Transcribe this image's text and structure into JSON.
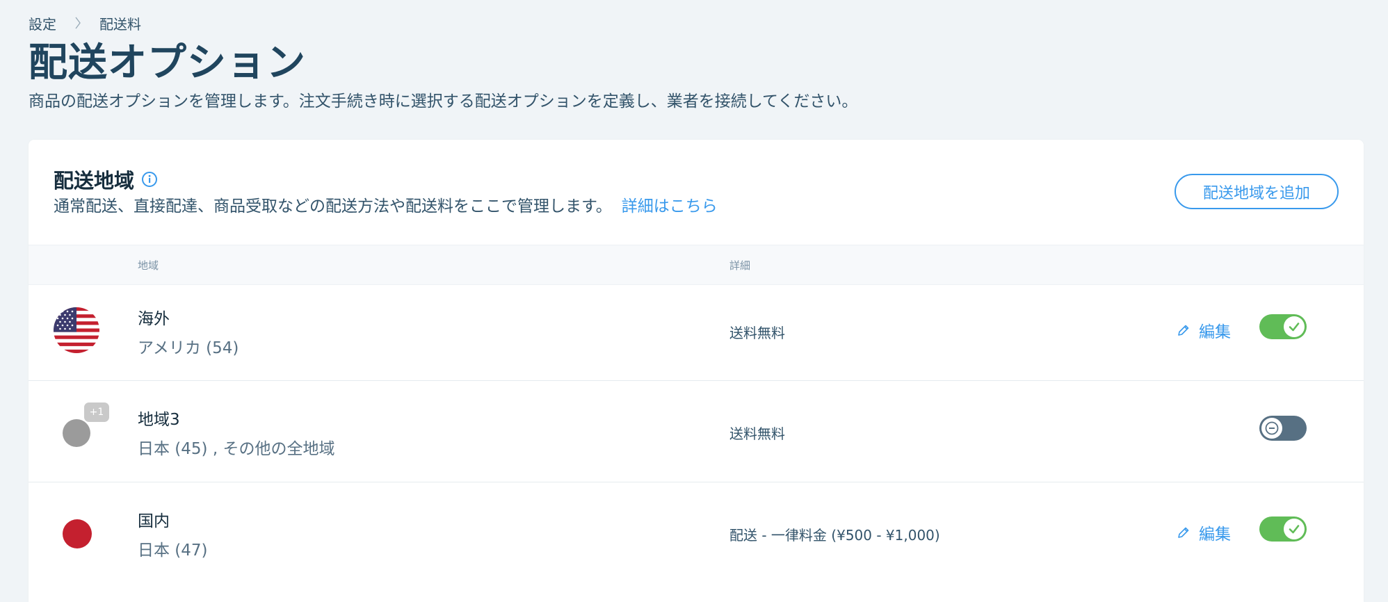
{
  "breadcrumb": {
    "parent": "設定",
    "current": "配送料"
  },
  "page": {
    "title": "配送オプション",
    "subtitle": "商品の配送オプションを管理します。注文手続き時に選択する配送オプションを定義し、業者を接続してください。"
  },
  "card": {
    "title": "配送地域",
    "description": "通常配送、直接配達、商品受取などの配送方法や配送料をここで管理します。",
    "learn_more": "詳細はこちら",
    "add_button": "配送地域を追加"
  },
  "table": {
    "columns": {
      "region": "地域",
      "details": "詳細"
    },
    "rows": [
      {
        "name": "海外",
        "sub": "アメリカ (54)",
        "detail": "送料無料",
        "edit": "編集",
        "icon": "us-flag-icon",
        "enabled": true,
        "editable": true
      },
      {
        "name": "地域3",
        "sub": "日本 (45) , その他の全地域",
        "detail": "送料無料",
        "badge": "+1",
        "icon": "multi-region-icon",
        "enabled": false,
        "editable": false
      },
      {
        "name": "国内",
        "sub": "日本 (47)",
        "detail": "配送 - 一律料金 (¥500 - ¥1,000)",
        "edit": "編集",
        "icon": "jp-flag-icon",
        "enabled": true,
        "editable": true
      }
    ]
  },
  "colors": {
    "accent": "#3899ec",
    "toggle_on": "#60bc57",
    "toggle_off": "#577083",
    "background": "#f0f4f7"
  }
}
